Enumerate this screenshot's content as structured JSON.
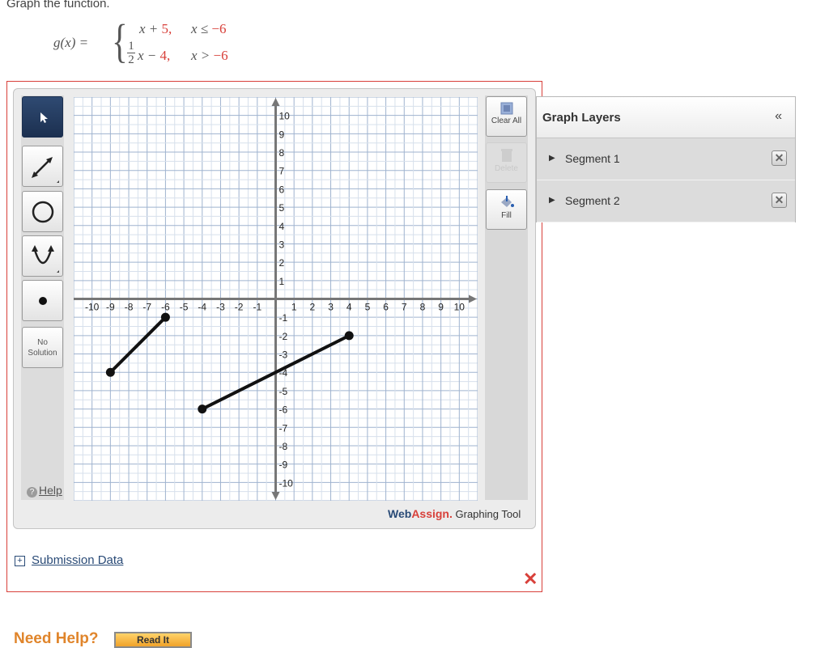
{
  "prompt": "Graph the function.",
  "function": {
    "name": "g(x) =",
    "piece1_expr": "x + ",
    "piece1_const": "5,",
    "piece1_cond": "x ≤ ",
    "piece1_cond_val": "−6",
    "piece2_frac_num": "1",
    "piece2_frac_den": "2",
    "piece2_expr": "x − ",
    "piece2_const": "4,",
    "piece2_cond": "x > ",
    "piece2_cond_val": "−6"
  },
  "toolbar": {
    "no_solution_line1": "No",
    "no_solution_line2": "Solution",
    "help_label": "Help"
  },
  "right_tools": {
    "clear_all": "Clear All",
    "delete": "Delete",
    "fill": "Fill"
  },
  "brand": {
    "web": "Web",
    "assign": "Assign.",
    "rest": " Graphing Tool"
  },
  "graph": {
    "x_ticks": [
      "-10",
      "-9",
      "-8",
      "-7",
      "-6",
      "-5",
      "-4",
      "-3",
      "-2",
      "-1",
      "1",
      "2",
      "3",
      "4",
      "5",
      "6",
      "7",
      "8",
      "9",
      "10"
    ],
    "y_ticks": [
      "10",
      "9",
      "8",
      "7",
      "6",
      "5",
      "4",
      "3",
      "2",
      "1",
      "-1",
      "-2",
      "-3",
      "-4",
      "-5",
      "-6",
      "-7",
      "-8",
      "-9",
      "-10"
    ],
    "range": [
      -11,
      11
    ],
    "segments": [
      {
        "name": "Segment 1",
        "from": [
          -9,
          -4
        ],
        "to": [
          -6,
          -1
        ]
      },
      {
        "name": "Segment 2",
        "from": [
          -4,
          -6
        ],
        "to": [
          4,
          -2
        ]
      }
    ]
  },
  "layers": {
    "title": "Graph Layers",
    "collapse": "«",
    "items": [
      {
        "label": "Segment 1"
      },
      {
        "label": "Segment 2"
      }
    ]
  },
  "submission_data": "Submission Data",
  "need_help": "Need Help?",
  "read_it": "Read It",
  "colors": {
    "accent_red": "#d8403a",
    "brand_blue": "#2a4b77",
    "help_orange": "#e0852b"
  }
}
